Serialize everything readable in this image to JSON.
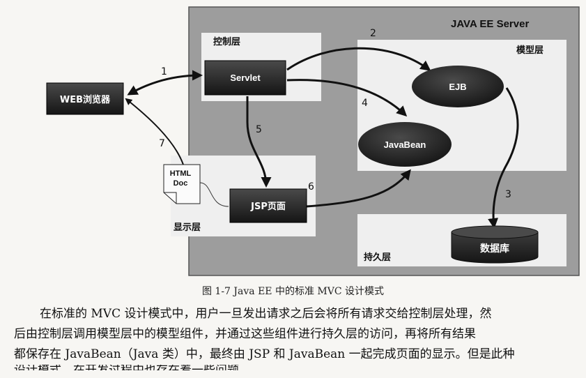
{
  "diagram": {
    "server_label": "JAVA EE Server",
    "control_layer": "控制层",
    "model_layer": "模型层",
    "view_layer": "显示层",
    "persistence_layer": "持久层",
    "browser": "WEB浏览器",
    "servlet": "Servlet",
    "ejb": "EJB",
    "javabean": "JavaBean",
    "jsp": "JSP页面",
    "html_doc_line1": "HTML",
    "html_doc_line2": "Doc",
    "database": "数据库",
    "step1": "1",
    "step2": "2",
    "step3": "3",
    "step4": "4",
    "step5": "5",
    "step6": "6",
    "step7": "7"
  },
  "caption": "图 1-7   Java EE 中的标准 MVC 设计模式",
  "paragraph": [
    "在标准的 MVC 设计模式中，用户一旦发出请求之后会将所有请求交给控制层处理，然",
    "后由控制层调用模型层中的模型组件，并通过这些组件进行持久层的访问，再将所有结果",
    "都保存在 JavaBean（Java 类）中，最终由 JSP 和 JavaBean 一起完成页面的显示。但是此种",
    "设计模式，在开发过程中也存在着一些问题"
  ]
}
